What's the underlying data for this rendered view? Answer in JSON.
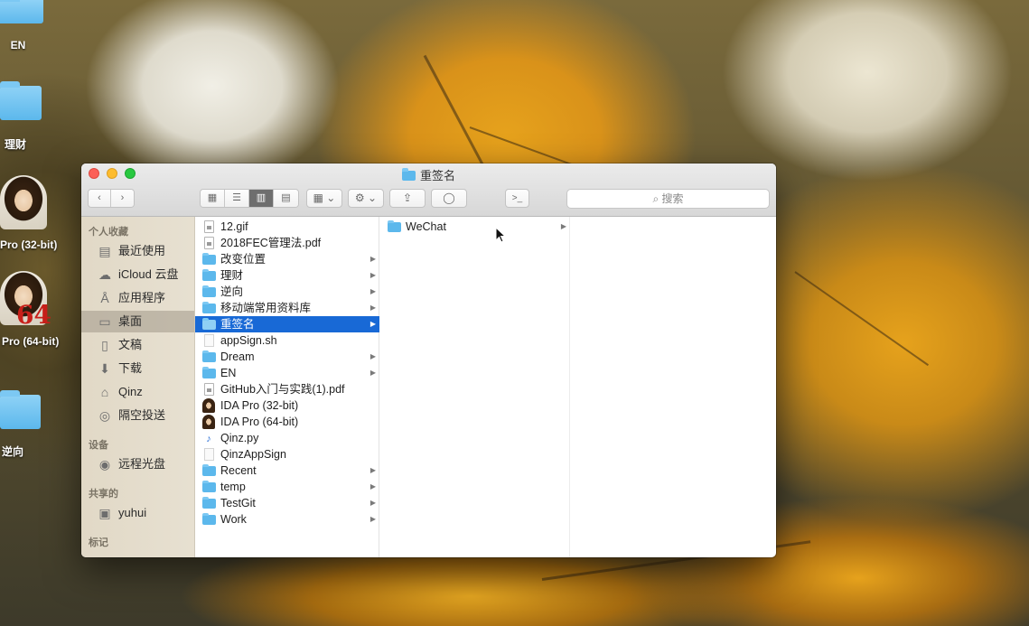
{
  "desktop": {
    "icons": [
      {
        "label": "EN"
      },
      {
        "label": "理财"
      },
      {
        "label": "Pro (32-bit)"
      },
      {
        "label": "Pro (64-bit)",
        "badge": "64"
      },
      {
        "label": "逆向"
      }
    ]
  },
  "window": {
    "title": "重签名",
    "search_placeholder": "搜索"
  },
  "sidebar": {
    "sections": [
      {
        "header": "个人收藏",
        "items": [
          "最近使用",
          "iCloud 云盘",
          "应用程序",
          "桌面",
          "文稿",
          "下载",
          "Qinz",
          "隔空投送"
        ]
      },
      {
        "header": "设备",
        "items": [
          "远程光盘"
        ]
      },
      {
        "header": "共享的",
        "items": [
          "yuhui"
        ]
      },
      {
        "header": "标记",
        "items": []
      }
    ],
    "selected": "桌面"
  },
  "column1": {
    "items": [
      {
        "name": "12.gif",
        "kind": "file"
      },
      {
        "name": "2018FEC管理法.pdf",
        "kind": "file"
      },
      {
        "name": "改变位置",
        "kind": "folder"
      },
      {
        "name": "理财",
        "kind": "folder"
      },
      {
        "name": "逆向",
        "kind": "folder"
      },
      {
        "name": "移动端常用资料库",
        "kind": "folder"
      },
      {
        "name": "重签名",
        "kind": "folder",
        "selected": true
      },
      {
        "name": "appSign.sh",
        "kind": "script"
      },
      {
        "name": "Dream",
        "kind": "folder"
      },
      {
        "name": "EN",
        "kind": "folder"
      },
      {
        "name": "GitHub入门与实践(1).pdf",
        "kind": "file"
      },
      {
        "name": "IDA Pro (32-bit)",
        "kind": "app"
      },
      {
        "name": "IDA Pro (64-bit)",
        "kind": "app"
      },
      {
        "name": "Qinz.py",
        "kind": "python"
      },
      {
        "name": "QinzAppSign",
        "kind": "script"
      },
      {
        "name": "Recent",
        "kind": "folder"
      },
      {
        "name": "temp",
        "kind": "folder"
      },
      {
        "name": "TestGit",
        "kind": "folder"
      },
      {
        "name": "Work",
        "kind": "folder"
      }
    ]
  },
  "column2": {
    "items": [
      {
        "name": "WeChat",
        "kind": "folder"
      }
    ]
  },
  "colors": {
    "selection": "#1869d6",
    "folder": "#5cb8ec",
    "close": "#fc5f57",
    "minimize": "#fdbc2e",
    "zoom": "#28c840"
  }
}
